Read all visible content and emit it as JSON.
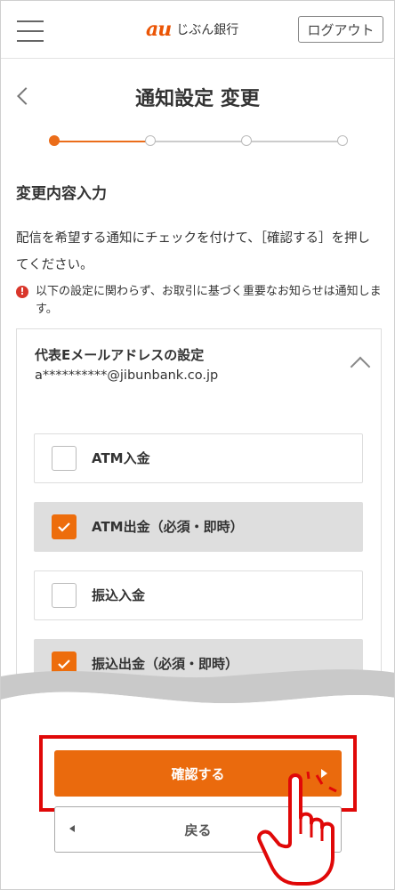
{
  "header": {
    "logo_mark": "au",
    "logo_text": "じぶん銀行",
    "logout_label": "ログアウト",
    "menu_icon": "hamburger-menu-icon"
  },
  "page": {
    "title": "通知設定 変更",
    "back_icon": "chevron-left-icon"
  },
  "stepper": {
    "total_steps": 4,
    "current_step": 1
  },
  "section": {
    "title": "変更内容入力",
    "description": "配信を希望する通知にチェックを付けて、［確認する］を押してください。",
    "notice": "以下の設定に関わらず、お取引に基づく重要なお知らせは通知します。",
    "notice_icon": "!"
  },
  "email": {
    "label": "代表Eメールアドレスの設定",
    "value": "a**********@jibunbank.co.jp"
  },
  "options": [
    {
      "label": "ATM入金",
      "checked": false
    },
    {
      "label": "ATM出金（必須・即時）",
      "checked": true
    },
    {
      "label": "振込入金",
      "checked": false
    },
    {
      "label": "振込出金（必須・即時）",
      "checked": true
    }
  ],
  "actions": {
    "confirm_label": "確認する",
    "back_label": "戻る"
  },
  "colors": {
    "accent": "#ea6a0d",
    "highlight": "#e00808",
    "alert": "#d9362b"
  }
}
